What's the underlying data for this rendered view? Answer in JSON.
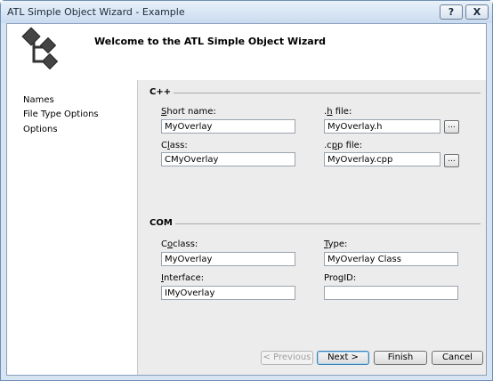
{
  "window": {
    "title": "ATL Simple Object Wizard - Example",
    "help_label": "?",
    "close_label": "X"
  },
  "header": {
    "title": "Welcome to the ATL Simple Object Wizard"
  },
  "sidebar": {
    "items": [
      {
        "label": "Names"
      },
      {
        "label": "File Type Options"
      },
      {
        "label": "Options"
      }
    ]
  },
  "cpp_group": {
    "title": "C++",
    "short_name": {
      "label_u": "S",
      "label_rest": "hort name:",
      "value": "MyOverlay"
    },
    "h_file": {
      "label_pre": ".",
      "label_u": "h",
      "label_rest": " file:",
      "value": "MyOverlay.h",
      "browse_label": "..."
    },
    "class": {
      "label_pre": "C",
      "label_u": "l",
      "label_rest": "ass:",
      "value": "CMyOverlay"
    },
    "cpp_file": {
      "label_pre": ".c",
      "label_u": "p",
      "label_rest": "p file:",
      "value": "MyOverlay.cpp",
      "browse_label": "..."
    }
  },
  "com_group": {
    "title": "COM",
    "coclass": {
      "label_pre": "C",
      "label_u": "o",
      "label_rest": "class:",
      "value": "MyOverlay"
    },
    "type": {
      "label_pre": "",
      "label_u": "T",
      "label_rest": "ype:",
      "value": "MyOverlay Class"
    },
    "interface": {
      "label_pre": "",
      "label_u": "I",
      "label_rest": "nterface:",
      "value": "IMyOverlay"
    },
    "progid": {
      "label_pre": "",
      "label_u": "",
      "label_rest": "ProgID:",
      "value": ""
    }
  },
  "buttons": {
    "previous": "< Previous",
    "next": "Next >",
    "finish": "Finish",
    "cancel": "Cancel"
  },
  "colors": {
    "title_bar": "#c9dbef",
    "content_bg": "#ececec",
    "frame": "#d7e4f2"
  }
}
